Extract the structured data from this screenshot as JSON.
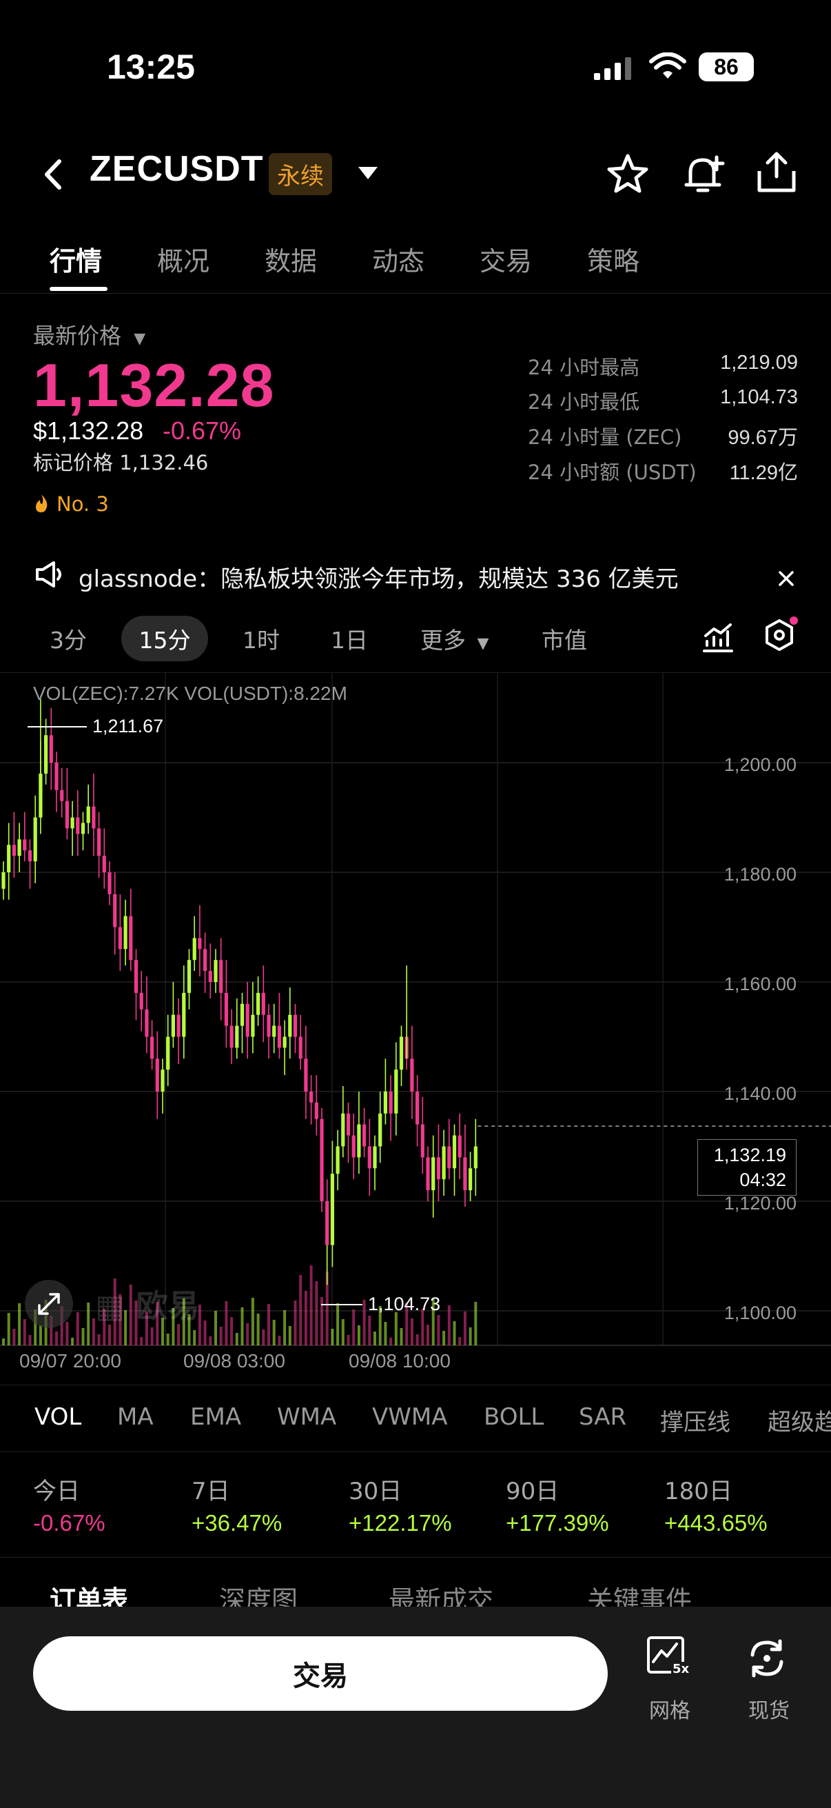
{
  "status": {
    "time": "13:25",
    "battery": "86"
  },
  "header": {
    "pair": "ZECUSDT",
    "contract_type": "永续"
  },
  "tabs": [
    {
      "label": "行情"
    },
    {
      "label": "概况"
    },
    {
      "label": "数据"
    },
    {
      "label": "动态"
    },
    {
      "label": "交易"
    },
    {
      "label": "策略"
    }
  ],
  "price": {
    "latest_label": "最新价格",
    "last": "1,132.28",
    "usd": "$1,132.28",
    "change_pct": "-0.67%",
    "mark_label": "标记价格",
    "mark": "1,132.46",
    "rank": "No. 3"
  },
  "stats": [
    {
      "label": "24 小时最高",
      "value": "1,219.09"
    },
    {
      "label": "24 小时最低",
      "value": "1,104.73"
    },
    {
      "label": "24 小时量 (ZEC)",
      "value": "99.67万"
    },
    {
      "label": "24 小时额 (USDT)",
      "value": "11.29亿"
    }
  ],
  "news": {
    "text": "glassnode：隐私板块领涨今年市场，规模达 336 亿美元"
  },
  "intervals": [
    {
      "label": "3分"
    },
    {
      "label": "15分"
    },
    {
      "label": "1时"
    },
    {
      "label": "1日"
    },
    {
      "label": "更多"
    },
    {
      "label": "市值"
    }
  ],
  "chart": {
    "vol_text": "VOL(ZEC):7.27K  VOL(USDT):8.22M",
    "high_label": "1,211.67",
    "low_label": "1,104.73",
    "current_price": "1,132.19",
    "countdown": "04:32",
    "y_ticks": [
      "1,200.00",
      "1,180.00",
      "1,160.00",
      "1,140.00",
      "1,120.00",
      "1,100.00"
    ],
    "x_ticks": [
      "09/07 20:00",
      "09/08 03:00",
      "09/08 10:00"
    ],
    "watermark": "欧易"
  },
  "chart_data": {
    "type": "candlestick",
    "ylim": [
      1092,
      1215
    ],
    "y_ticks": [
      1200,
      1180,
      1160,
      1140,
      1120,
      1100
    ],
    "x_ticks": [
      "09/07 20:00",
      "09/08 03:00",
      "09/08 10:00"
    ],
    "current_price": 1132.19,
    "colors": {
      "up": "#b7ff3c",
      "down": "#f0398f"
    },
    "close": [
      1180,
      1185,
      1183,
      1186,
      1184,
      1182,
      1190,
      1198,
      1205,
      1200,
      1195,
      1193,
      1188,
      1190,
      1187,
      1189,
      1192,
      1188,
      1183,
      1180,
      1176,
      1170,
      1166,
      1172,
      1164,
      1158,
      1155,
      1150,
      1146,
      1140,
      1144,
      1150,
      1154,
      1150,
      1158,
      1164,
      1168,
      1166,
      1162,
      1160,
      1164,
      1158,
      1152,
      1148,
      1152,
      1156,
      1150,
      1154,
      1158,
      1154,
      1150,
      1152,
      1148,
      1150,
      1154,
      1150,
      1146,
      1140,
      1138,
      1135,
      1120,
      1112,
      1125,
      1130,
      1136,
      1132,
      1128,
      1134,
      1130,
      1126,
      1130,
      1136,
      1140,
      1136,
      1144,
      1150,
      1146,
      1140,
      1134,
      1128,
      1122,
      1128,
      1124,
      1130,
      1126,
      1132,
      1128,
      1122,
      1126,
      1130
    ],
    "volume_note": "bars at bottom of chart; relative heights only"
  },
  "indicators": [
    "VOL",
    "MA",
    "EMA",
    "WMA",
    "VWMA",
    "BOLL",
    "SAR",
    "撑压线",
    "超级趋势"
  ],
  "performance": [
    {
      "label": "今日",
      "value": "-0.67%",
      "dir": "down"
    },
    {
      "label": "7日",
      "value": "+36.47%",
      "dir": "up"
    },
    {
      "label": "30日",
      "value": "+122.17%",
      "dir": "up"
    },
    {
      "label": "90日",
      "value": "+177.39%",
      "dir": "up"
    },
    {
      "label": "180日",
      "value": "+443.65%",
      "dir": "up"
    }
  ],
  "orderbook_tabs": [
    {
      "label": "订单表"
    },
    {
      "label": "深度图"
    },
    {
      "label": "最新成交"
    },
    {
      "label": "关键事件"
    }
  ],
  "bottom": {
    "trade": "交易",
    "grid": "网格",
    "grid_badge": "5x",
    "spot": "现货"
  }
}
